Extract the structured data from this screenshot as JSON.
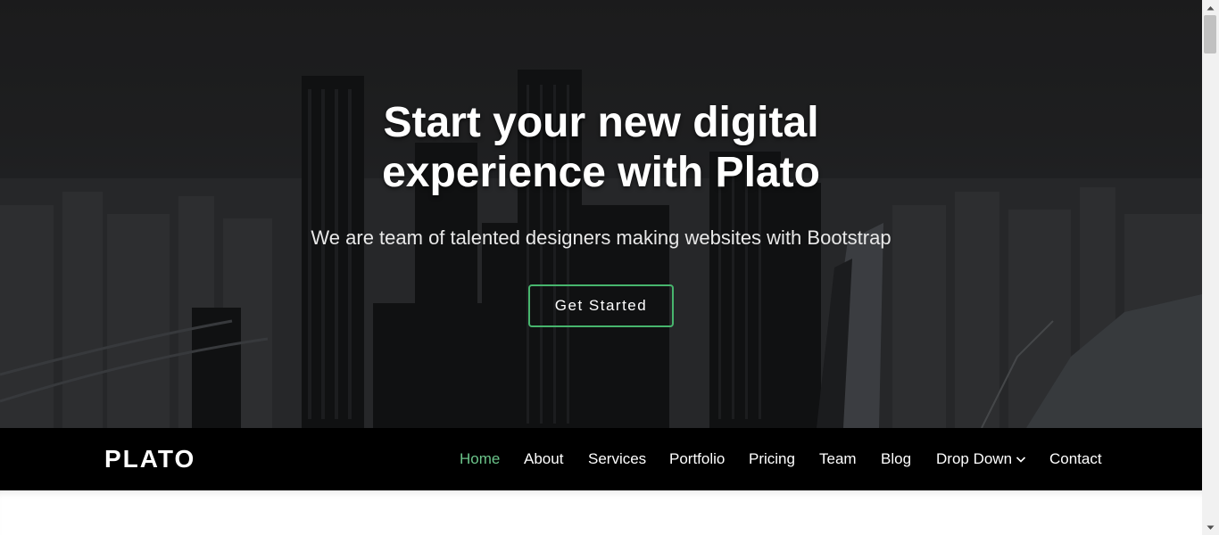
{
  "hero": {
    "title_line1": "Start your new digital",
    "title_line2": "experience with Plato",
    "subtitle": "We are team of talented designers making websites with Bootstrap",
    "cta_label": "Get Started"
  },
  "navbar": {
    "logo": "PLATO",
    "items": [
      {
        "label": "Home",
        "active": true
      },
      {
        "label": "About"
      },
      {
        "label": "Services"
      },
      {
        "label": "Portfolio"
      },
      {
        "label": "Pricing"
      },
      {
        "label": "Team"
      },
      {
        "label": "Blog"
      },
      {
        "label": "Drop Down",
        "icon": "chevron-down-icon"
      },
      {
        "label": "Contact"
      }
    ]
  },
  "colors": {
    "accent": "#47b56d",
    "active_link": "#6bc48a",
    "navbar_bg": "#000000"
  }
}
